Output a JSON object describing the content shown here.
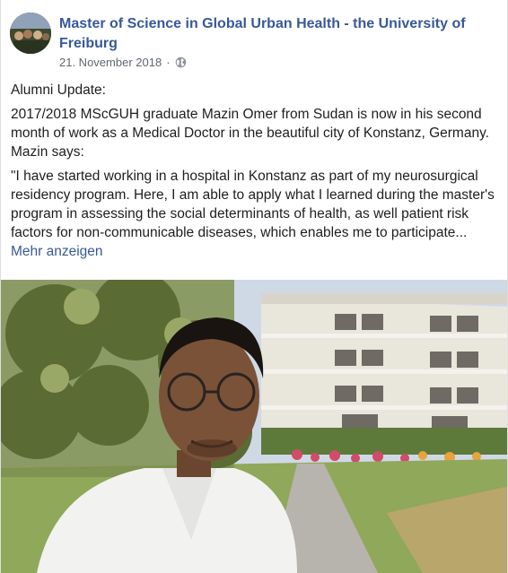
{
  "post": {
    "page_name": "Master of Science in Global Urban Health - the University of Freiburg",
    "date": "21. November 2018",
    "separator": "·",
    "privacy_icon": "globe-icon",
    "paragraphs": [
      "Alumni Update:",
      "2017/2018 MScGUH graduate Mazin Omer from Sudan is now in his second month of work as a Medical Doctor in the beautiful city of Konstanz, Germany. Mazin says:",
      "\"I have started working in a hospital in Konstanz as part of my neurosurgical residency program. Here, I am able to apply what I learned during the master's program in assessing the social determinants of health, as well patient risk factors for non-communicable diseases, which enables me to participate..."
    ],
    "see_more": "Mehr anzeigen"
  },
  "colors": {
    "link": "#385898",
    "text": "#1c1e21",
    "meta": "#616770"
  }
}
